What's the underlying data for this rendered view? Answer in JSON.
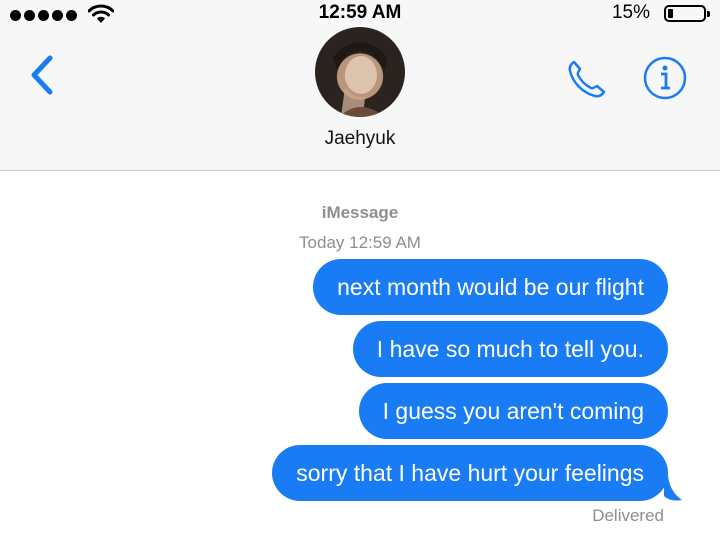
{
  "status_bar": {
    "time": "12:59 AM",
    "battery_percent": "15%",
    "battery_level": 0.15,
    "signal_bars": 5,
    "icons": [
      "signal-dots-icon",
      "wifi-icon",
      "battery-icon"
    ]
  },
  "header": {
    "contact_name": "Jaehyuk",
    "icons": [
      "back-chevron-icon",
      "phone-icon",
      "info-icon"
    ],
    "accent_color": "#1a7cf5"
  },
  "conversation": {
    "service": "iMessage",
    "timestamp": "Today 12:59 AM",
    "messages": [
      {
        "text": "next month would be our flight",
        "sender": "me"
      },
      {
        "text": "I have so much to tell you.",
        "sender": "me"
      },
      {
        "text": "I guess you aren't coming",
        "sender": "me"
      },
      {
        "text": "sorry that I have hurt your feelings",
        "sender": "me"
      }
    ],
    "delivery_status": "Delivered",
    "bubble_color": "#1a7cf5"
  }
}
